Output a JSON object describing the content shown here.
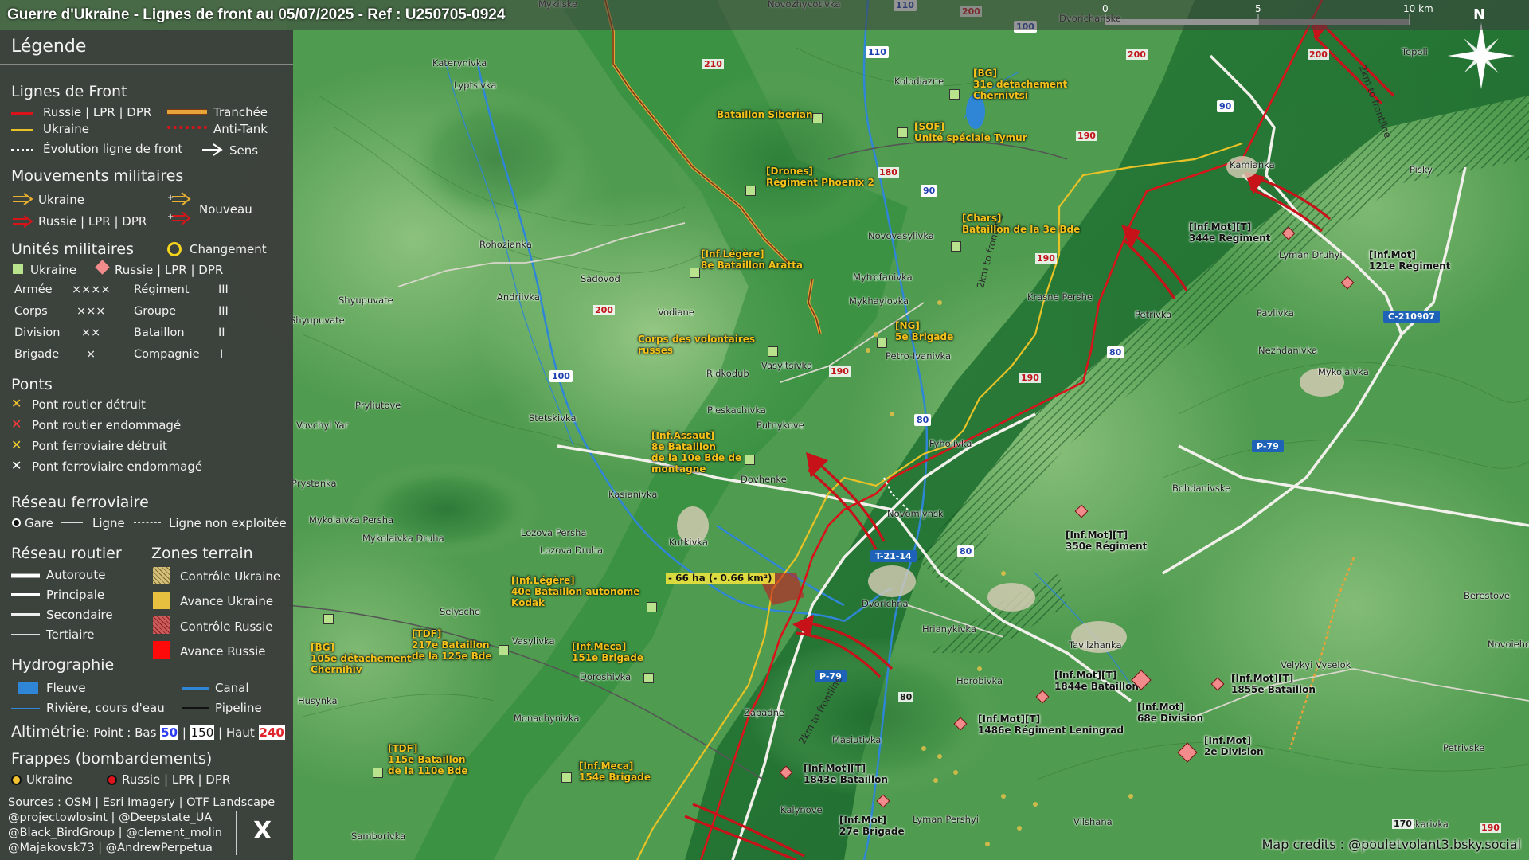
{
  "title": "Guerre d'Ukraine - Lignes de front au 05/07/2025 - Ref : U250705-0924",
  "scalebar": {
    "ticks": [
      "0",
      "5",
      "10 km"
    ]
  },
  "compass": {
    "north": "N"
  },
  "legend": {
    "header": "Légende",
    "front_lines": {
      "heading": "Lignes de Front",
      "russia": "Russie | LPR | DPR",
      "ukraine": "Ukraine",
      "evolution": "Évolution ligne de front",
      "trench": "Tranchée",
      "antitank": "Anti-Tank",
      "direction": "Sens"
    },
    "movements": {
      "heading": "Mouvements militaires",
      "ukraine": "Ukraine",
      "russia": "Russie | LPR | DPR",
      "new": "Nouveau"
    },
    "units": {
      "heading": "Unités militaires",
      "change": "Changement",
      "ukraine": "Ukraine",
      "russia": "Russie | LPR | DPR",
      "rows": [
        {
          "name": "Armée",
          "sym": "××××",
          "name2": "Régiment",
          "sym2": "III"
        },
        {
          "name": "Corps",
          "sym": "×××",
          "name2": "Groupe",
          "sym2": "III"
        },
        {
          "name": "Division",
          "sym": "××",
          "name2": "Bataillon",
          "sym2": "II"
        },
        {
          "name": "Brigade",
          "sym": "×",
          "name2": "Compagnie",
          "sym2": "I"
        }
      ]
    },
    "bridges": {
      "heading": "Ponts",
      "items": [
        "Pont routier détruit",
        "Pont routier endommagé",
        "Pont ferroviaire détruit",
        "Pont ferroviaire endommagé"
      ]
    },
    "rail": {
      "heading": "Réseau ferroviaire",
      "station": "Gare",
      "line": "Ligne",
      "unused": "Ligne non exploitée"
    },
    "roads": {
      "heading": "Réseau routier",
      "items": [
        "Autoroute",
        "Principale",
        "Secondaire",
        "Tertiaire"
      ]
    },
    "terrain": {
      "heading": "Zones terrain",
      "items": [
        "Contrôle Ukraine",
        "Avance Ukraine",
        "Contrôle Russie",
        "Avance Russie"
      ]
    },
    "hydro": {
      "heading": "Hydrographie",
      "river": "Fleuve",
      "stream": "Rivière, cours d'eau",
      "canal": "Canal",
      "pipeline": "Pipeline"
    },
    "altitude": {
      "heading": "Altimétrie",
      "text1": ": Point : Bas ",
      "low": "50",
      "sep1": " | ",
      "mid": "150",
      "text2": " | Haut ",
      "high": "240"
    },
    "strikes": {
      "heading": "Frappes (bombardements)",
      "ukraine": "Ukraine",
      "russia": "Russie | LPR | DPR"
    },
    "sources": [
      "Sources : OSM | Esri Imagery | OTF Landscape",
      "@projectowlosint | @Deepstate_UA",
      "@Black_BirdGroup | @clement_molin",
      "@Majakovsk73 | @AndrewPerpetua"
    ],
    "x_logo": "X"
  },
  "map": {
    "credits": "Map credits : @pouletvolant3.bsky.social",
    "towns": [
      "Mykilske",
      "Novozhyvotivka",
      "Dvorichanske",
      "Topoli",
      "Katerynivka",
      "Lyptsivka",
      "Kolodiazne",
      "Kamianka",
      "Pisky",
      "Rohozianka",
      "Sadovod",
      "Novovasylivka",
      "Andriivka",
      "Shyupuvate",
      "Mytrofanivka",
      "Mykhaylovka",
      "Krasne Pershe",
      "Lyman Druhyi",
      "Pavlivka",
      "Vodiane",
      "Petro-Ivanivka",
      "Petrivka",
      "Nezhdanivka",
      "Mykolaivka",
      "Ridkodub",
      "Vasyltsivka",
      "Pryliutove",
      "Stetskivka",
      "Pleskachivka",
      "Putnykove",
      "Fyholivka",
      "Dovhenke",
      "Bohdanivske",
      "Kasianivka",
      "Novomlynsk",
      "Mykolaivka Persha",
      "Lozova Persha",
      "Mykolaivka Druha",
      "Kutkivka",
      "Lozova Druha",
      "Dvorichna",
      "Berestove",
      "Selysche",
      "Vasylivka",
      "Hrianykivka",
      "Tavilzhanka",
      "Novoiehorivka",
      "Doroshivka",
      "Horobivka",
      "Velykyi Vyselok",
      "Husynka",
      "Monachynivka",
      "Zapadne",
      "Masiutivka",
      "Petrivske",
      "Kalynove",
      "Lyman Pershyi",
      "Vilshana",
      "Tokarivka",
      "Samborivka",
      "Vovchyi Yar",
      "Prystanka",
      "Shyupuvate"
    ],
    "road_badges": [
      "110",
      "100",
      "110",
      "90",
      "90",
      "80",
      "80",
      "80",
      "100",
      "P-79",
      "P-79",
      "T-21-14",
      "C-210907"
    ],
    "altitude_points": [
      "200",
      "210",
      "200",
      "200",
      "180",
      "190",
      "200",
      "190",
      "190",
      "190",
      "80",
      "170",
      "190"
    ],
    "frontline_tags": [
      "2km to frontline",
      "2km to frontline",
      "2km to frontline"
    ],
    "area_note": "- 66 ha (- 0.66 km²)",
    "ukraine_units": [
      {
        "line1": "[BG]",
        "line2": "31e détachement",
        "line3": "Chernivtsi"
      },
      {
        "line1": "Bataillon Siberian",
        "line2": "",
        "line3": ""
      },
      {
        "line1": "[SOF]",
        "line2": "Unité spéciale Tymur",
        "line3": ""
      },
      {
        "line1": "[Drones]",
        "line2": "Régiment Phoenix 2",
        "line3": ""
      },
      {
        "line1": "[Chars]",
        "line2": "Bataillon de la 3e Bde",
        "line3": ""
      },
      {
        "line1": "[Inf.Légère]",
        "line2": "8e Bataillon Aratta",
        "line3": ""
      },
      {
        "line1": "[NG]",
        "line2": "5e Brigade",
        "line3": ""
      },
      {
        "line1": "Corps des volontaires",
        "line2": "russes",
        "line3": ""
      },
      {
        "line1": "[Inf.Assaut]",
        "line2": "8e Bataillon",
        "line3": "de la 10e Bde de",
        "line4": "montagne"
      },
      {
        "line1": "[Inf.Légère]",
        "line2": "40e Bataillon autonome",
        "line3": "Kodak"
      },
      {
        "line1": "[TDF]",
        "line2": "217e Bataillon",
        "line3": "de la 125e Bde"
      },
      {
        "line1": "[Inf.Meca]",
        "line2": "151e Brigade",
        "line3": ""
      },
      {
        "line1": "[BG]",
        "line2": "105e détachement",
        "line3": "Chernihiv"
      },
      {
        "line1": "[TDF]",
        "line2": "115e Bataillon",
        "line3": "de la 110e Bde"
      },
      {
        "line1": "[Inf.Meca]",
        "line2": "154e Brigade",
        "line3": ""
      }
    ],
    "russian_units": [
      {
        "line1": "[Inf.Mot][T]",
        "line2": "344e Régiment"
      },
      {
        "line1": "[Inf.Mot]",
        "line2": "121e Régiment"
      },
      {
        "line1": "[Inf.Mot][T]",
        "line2": "350e Régiment"
      },
      {
        "line1": "[Inf.Mot][T]",
        "line2": "1844e Bataillon"
      },
      {
        "line1": "[Inf.Mot]",
        "line2": "68e Division"
      },
      {
        "line1": "[Inf.Mot][T]",
        "line2": "1855e Bataillon"
      },
      {
        "line1": "[Inf.Mot][T]",
        "line2": "1486e Régiment Leningrad"
      },
      {
        "line1": "[Inf.Mot]",
        "line2": "2e Division"
      },
      {
        "line1": "[Inf.Mot][T]",
        "line2": "1843e Bataillon"
      },
      {
        "line1": "[Inf.Mot]",
        "line2": "27e Brigade"
      }
    ],
    "colors": {
      "russia_line": "#d9131a",
      "ukraine_line": "#e8c227",
      "ukraine_unit": "#b9e28c",
      "russia_unit": "#f28b8b",
      "road_badge_blue": "#1e63b8"
    }
  }
}
